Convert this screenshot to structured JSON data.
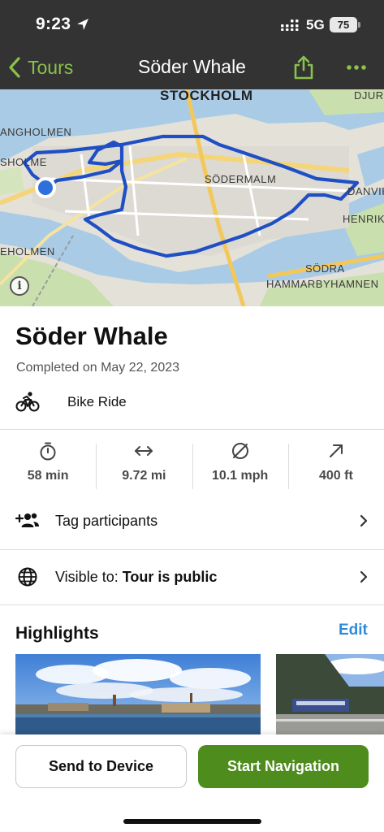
{
  "status_bar": {
    "time": "9:23",
    "network": "5G",
    "battery": "75"
  },
  "nav": {
    "back_label": "Tours",
    "title": "Söder Whale"
  },
  "map": {
    "labels": {
      "stockholm": "STOCKHOLM",
      "djurgarden": "DJUR",
      "langholmen_top": "ANGHOLMEN",
      "sholme": "SHOLME",
      "sodermalm": "SÖDERMALM",
      "danvik": "DANVIK",
      "henrik": "HENRIK",
      "eholmen": "EHOLMEN",
      "sodra": "SÖDRA",
      "hammarby": "HAMMARBYHAMNEN"
    },
    "route_color": "#1f4fc4",
    "water_color": "#a9cbe6"
  },
  "tour": {
    "title": "Söder Whale",
    "completed": "Completed on May 22, 2023",
    "sport": "Bike Ride"
  },
  "stats": [
    {
      "icon": "stopwatch-icon",
      "value": "58 min"
    },
    {
      "icon": "distance-arrows-icon",
      "value": "9.72 mi"
    },
    {
      "icon": "average-speed-icon",
      "value": "10.1 mph"
    },
    {
      "icon": "elevation-up-icon",
      "value": "400 ft"
    }
  ],
  "rows": {
    "tag_participants": "Tag participants",
    "visibility_prefix": "Visible to: ",
    "visibility_value": "Tour is public"
  },
  "highlights": {
    "title": "Highlights",
    "edit": "Edit"
  },
  "actions": {
    "send_to_device": "Send to Device",
    "start_navigation": "Start Navigation"
  },
  "colors": {
    "accent_green": "#8ac14a",
    "primary_button": "#4d8c1d",
    "link_blue": "#2e8bdb",
    "header_bg": "#333333"
  }
}
